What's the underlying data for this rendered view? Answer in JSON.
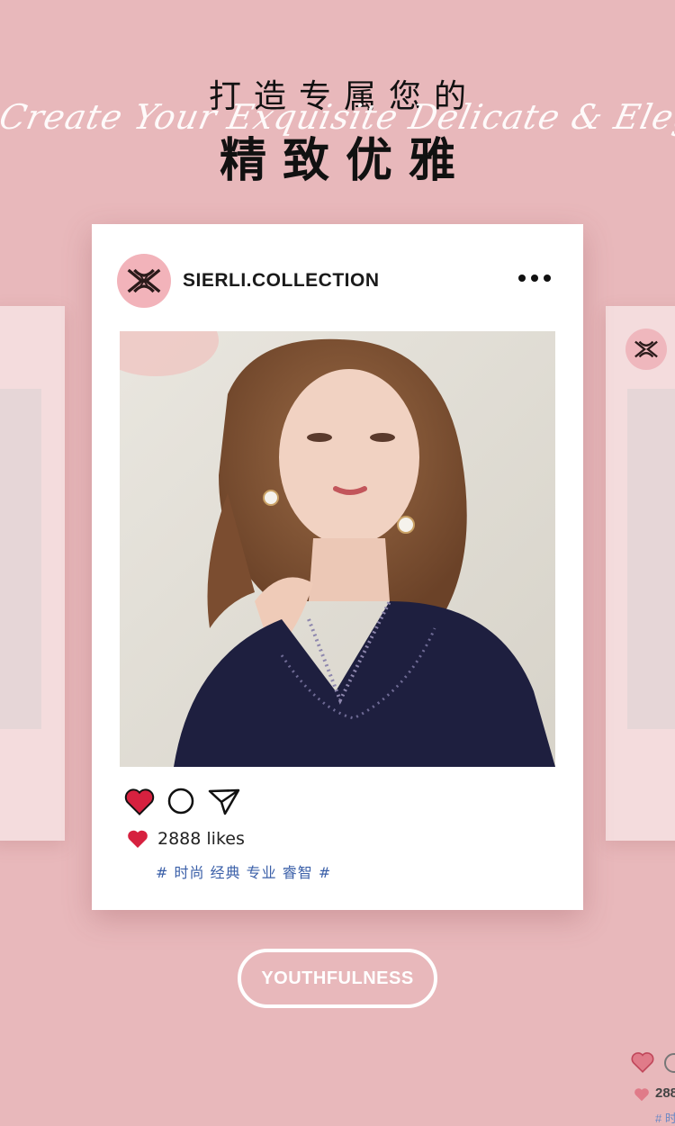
{
  "header": {
    "title_line1": "打造专属您的",
    "script_text": "Create Your Exquisite Delicate & Elegance",
    "title_line2": "精致优雅"
  },
  "post": {
    "account_name": "SIERLI.COLLECTION",
    "likes": "2888 likes",
    "tags": "# 时尚 经典 专业 睿智 #",
    "icons": [
      "heart-icon",
      "comment-icon",
      "share-icon",
      "more-icon"
    ]
  },
  "side_card": {
    "likes": "288",
    "tags": "# 时"
  },
  "cta": {
    "label": "YOUTHFULNESS"
  },
  "colors": {
    "background": "#e8b8bb",
    "card": "#ffffff",
    "logo_bg": "#f2b3ba",
    "heart": "#d6213f",
    "tag_text": "#3a5fa8"
  }
}
